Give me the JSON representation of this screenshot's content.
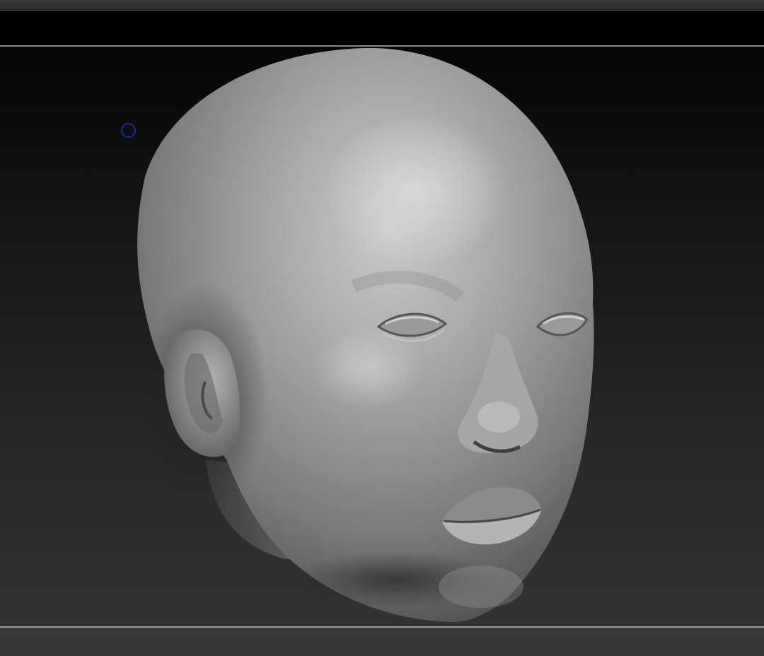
{
  "app": {
    "accent_cursor_color": "#1a24b8",
    "viewport_background": "dark-gradient"
  },
  "viewport": {
    "model": "sculpted-head",
    "cursor_icon": "brush-cursor-icon"
  }
}
